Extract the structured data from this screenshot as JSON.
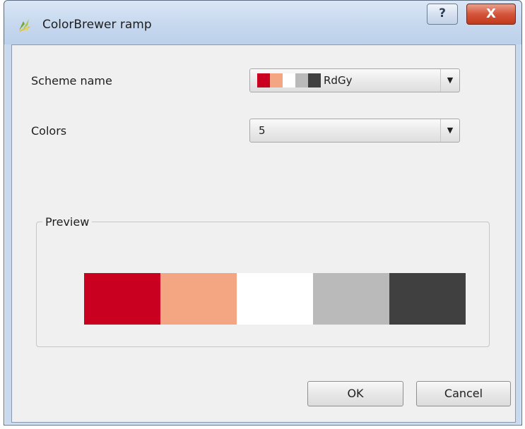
{
  "window": {
    "title": "ColorBrewer ramp",
    "help_label": "?",
    "close_label": "X"
  },
  "form": {
    "scheme_label": "Scheme name",
    "scheme_value": "RdGy",
    "scheme_swatch_colors": [
      "#ca0020",
      "#f4a582",
      "#ffffff",
      "#bababa",
      "#404040"
    ],
    "colors_label": "Colors",
    "colors_value": "5"
  },
  "preview": {
    "title": "Preview",
    "colors": [
      "#ca0020",
      "#f4a582",
      "#ffffff",
      "#bababa",
      "#404040"
    ]
  },
  "buttons": {
    "ok_label": "OK",
    "cancel_label": "Cancel"
  },
  "icons": {
    "app": "qgis-icon",
    "dropdown": "chevron-down-icon"
  }
}
